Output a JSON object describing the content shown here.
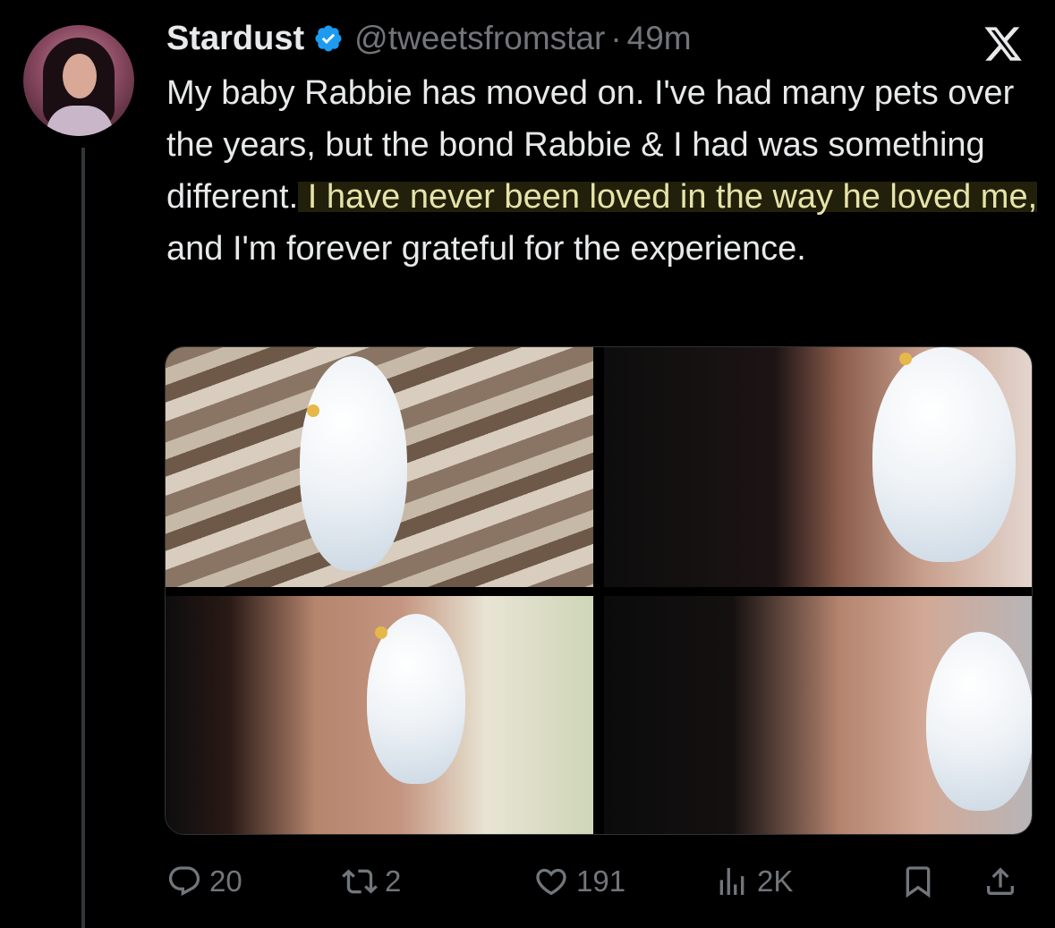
{
  "author": {
    "name": "Stardust",
    "handle": "@tweetsfromstar",
    "separator": "·",
    "time": "49m",
    "verified": true
  },
  "tweet": {
    "text_before": "My baby Rabbie has moved on. I've had many pets over the years, but the bond Rabbie & I had was something different.",
    "text_highlight": " I have never been loved in the way he loved me,",
    "text_after": " and I'm forever grateful for the experience."
  },
  "media": {
    "photos": [
      "budgie-on-towel",
      "woman-with-budgie-1",
      "woman-with-budgie-2",
      "woman-with-budgie-3"
    ]
  },
  "actions": {
    "reply_count": "20",
    "retweet_count": "2",
    "like_count": "191",
    "view_count": "2K"
  },
  "icons": {
    "verified": "verified-badge-icon",
    "x_logo": "x-logo-icon",
    "reply": "reply-icon",
    "retweet": "retweet-icon",
    "like": "heart-icon",
    "views": "views-icon",
    "bookmark": "bookmark-icon",
    "share": "share-icon"
  },
  "colors": {
    "background": "#000000",
    "text": "#e7e9ea",
    "secondary": "#71767b",
    "verified": "#1d9bf0",
    "highlight_text": "#e5e3a8"
  }
}
